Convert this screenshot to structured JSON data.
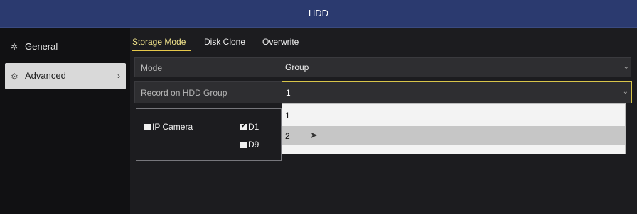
{
  "window": {
    "title": "HDD"
  },
  "sidebar": {
    "items": [
      {
        "label": "General",
        "icon": "gear-icon",
        "selected": false
      },
      {
        "label": "Advanced",
        "icon": "advanced-gear-icon",
        "selected": true
      }
    ]
  },
  "tabs": [
    {
      "label": "Storage Mode",
      "active": true
    },
    {
      "label": "Disk Clone",
      "active": false
    },
    {
      "label": "Overwrite",
      "active": false
    }
  ],
  "form": {
    "mode": {
      "label": "Mode",
      "value": "Group"
    },
    "hdd_group": {
      "label": "Record on HDD Group",
      "value": "1"
    }
  },
  "cameras": [
    {
      "label": "IP Camera",
      "checked": false
    },
    {
      "label": "D1",
      "checked": true
    },
    {
      "label": "D9",
      "checked": false
    }
  ],
  "dropdown": {
    "options": [
      "1",
      "2"
    ],
    "highlighted": "2"
  },
  "colors": {
    "title_bar": "#2b3a6f",
    "accent": "#e6c84a",
    "focus_border": "#d8c54a"
  }
}
